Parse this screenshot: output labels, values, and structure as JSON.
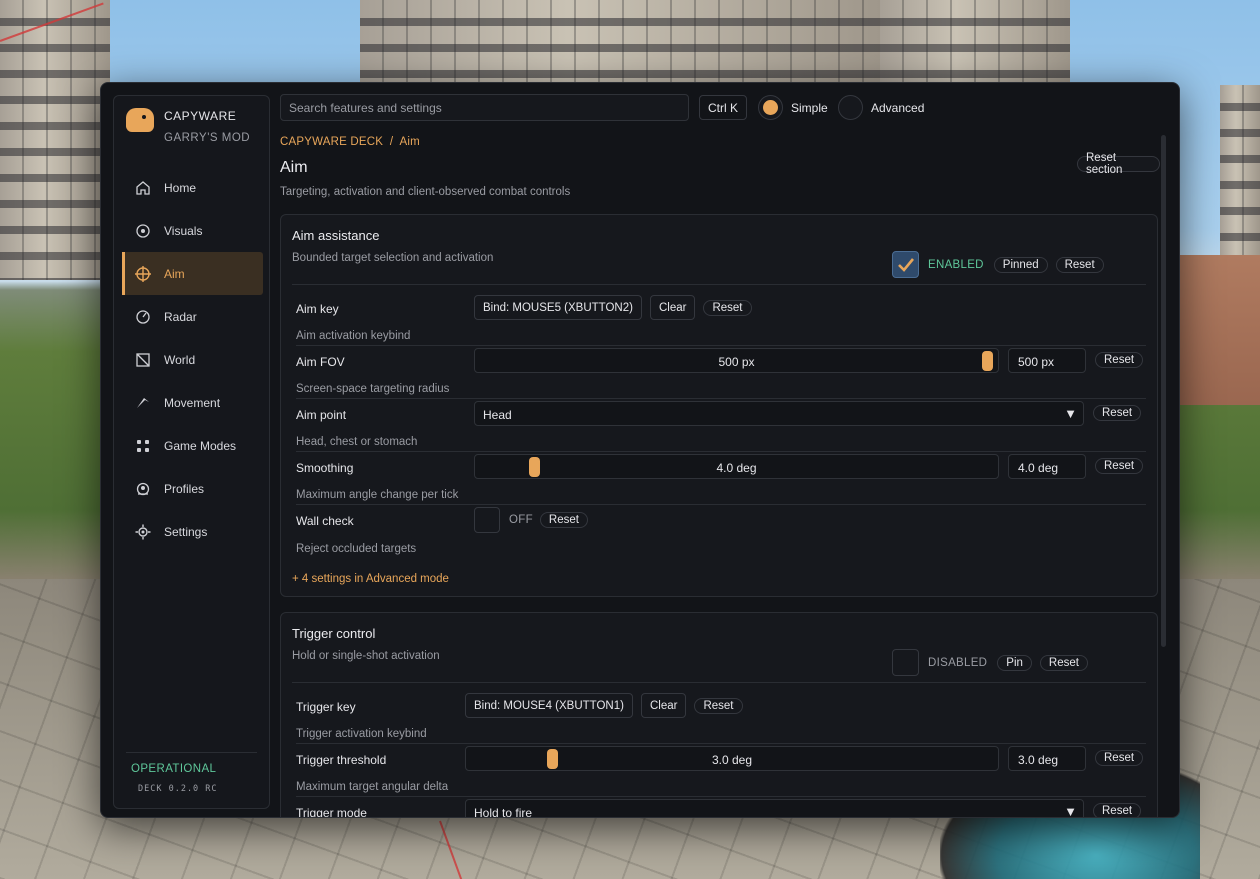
{
  "brand": {
    "name": "CAPYWARE",
    "game": "GARRY'S MOD"
  },
  "nav": [
    {
      "label": "Home",
      "icon": "home-icon"
    },
    {
      "label": "Visuals",
      "icon": "eye-icon"
    },
    {
      "label": "Aim",
      "icon": "crosshair-icon",
      "active": true
    },
    {
      "label": "Radar",
      "icon": "radar-icon"
    },
    {
      "label": "World",
      "icon": "world-icon"
    },
    {
      "label": "Movement",
      "icon": "movement-icon"
    },
    {
      "label": "Game Modes",
      "icon": "grid-icon"
    },
    {
      "label": "Profiles",
      "icon": "profile-icon"
    },
    {
      "label": "Settings",
      "icon": "gear-icon"
    }
  ],
  "footer": {
    "status": "OPERATIONAL",
    "version": "DECK 0.2.0 RC"
  },
  "topbar": {
    "search_placeholder": "Search features and settings",
    "shortcut": "Ctrl K",
    "mode_simple": "Simple",
    "mode_advanced": "Advanced",
    "mode_selected": "Simple"
  },
  "page": {
    "breadcrumb": "CAPYWARE DECK  /  Aim",
    "title": "Aim",
    "subtitle": "Targeting, activation and client-observed combat controls",
    "reset_section": "Reset section"
  },
  "aim_assist": {
    "title": "Aim assistance",
    "subtitle": "Bounded target selection and activation",
    "enabled": true,
    "state_label": "ENABLED",
    "pinned_label": "Pinned",
    "reset_label": "Reset",
    "aim_key": {
      "label": "Aim key",
      "bind": "Bind: MOUSE5 (XBUTTON2)",
      "clear": "Clear",
      "reset": "Reset",
      "hint": "Aim activation keybind"
    },
    "aim_fov": {
      "label": "Aim FOV",
      "value": 500,
      "max": 500,
      "display": "500 px",
      "reset": "Reset",
      "hint": "Screen-space targeting radius"
    },
    "aim_point": {
      "label": "Aim point",
      "value": "Head",
      "reset": "Reset",
      "hint": "Head, chest or stomach"
    },
    "smoothing": {
      "label": "Smoothing",
      "value": 4.0,
      "max": 40,
      "display": "4.0 deg",
      "reset": "Reset",
      "hint": "Maximum angle change per tick"
    },
    "wall_check": {
      "label": "Wall check",
      "state": "OFF",
      "reset": "Reset",
      "hint": "Reject occluded targets"
    },
    "advanced_link": "+ 4 settings in Advanced mode"
  },
  "trigger": {
    "title": "Trigger control",
    "subtitle": "Hold or single-shot activation",
    "enabled": false,
    "state_label": "DISABLED",
    "pin_label": "Pin",
    "reset_label": "Reset",
    "trigger_key": {
      "label": "Trigger key",
      "bind": "Bind: MOUSE4 (XBUTTON1)",
      "clear": "Clear",
      "reset": "Reset",
      "hint": "Trigger activation keybind"
    },
    "threshold": {
      "label": "Trigger threshold",
      "value": 3.0,
      "max": 20,
      "display": "3.0 deg",
      "reset": "Reset",
      "hint": "Maximum target angular delta"
    },
    "mode": {
      "label": "Trigger mode",
      "value": "Hold to fire",
      "reset": "Reset"
    }
  }
}
